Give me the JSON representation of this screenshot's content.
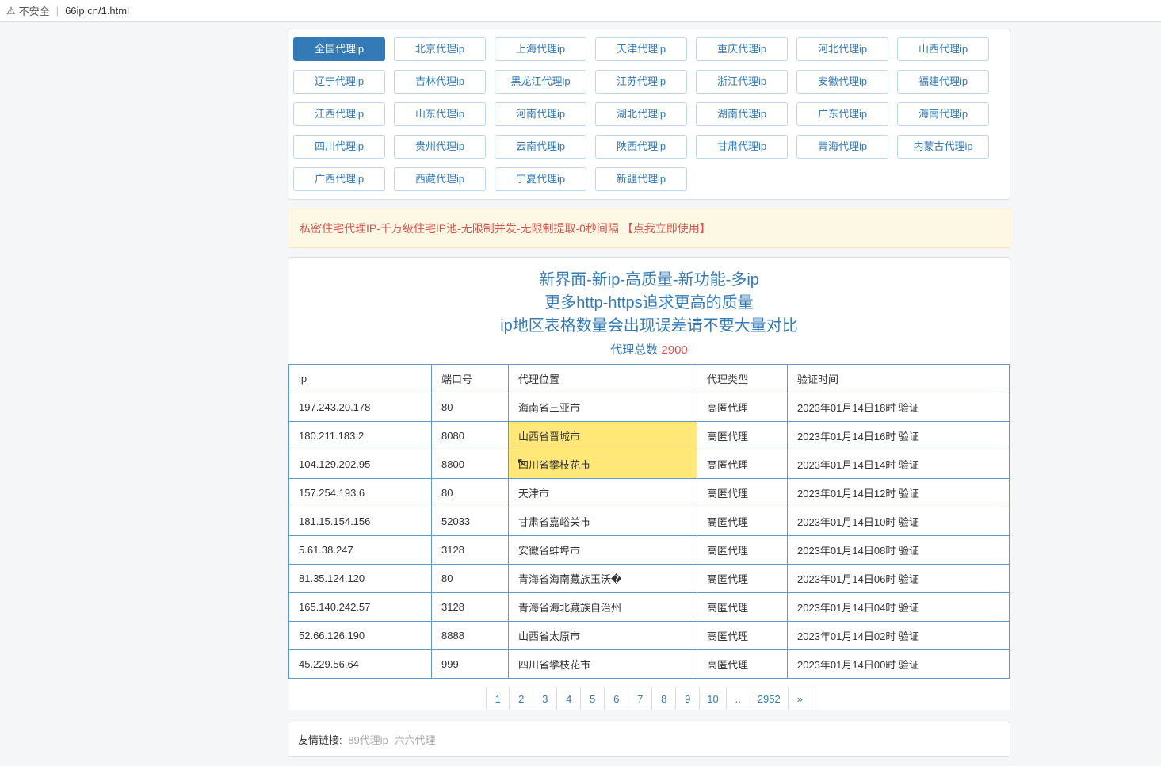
{
  "address_bar": {
    "warn_icon": "⚠",
    "warn_label": "不安全",
    "url": "66ip.cn/1.html"
  },
  "regions": {
    "active_index": 0,
    "items": [
      "全国代理ip",
      "北京代理ip",
      "上海代理ip",
      "天津代理ip",
      "重庆代理ip",
      "河北代理ip",
      "山西代理ip",
      "辽宁代理ip",
      "吉林代理ip",
      "黑龙江代理ip",
      "江苏代理ip",
      "浙江代理ip",
      "安徽代理ip",
      "福建代理ip",
      "江西代理ip",
      "山东代理ip",
      "河南代理ip",
      "湖北代理ip",
      "湖南代理ip",
      "广东代理ip",
      "海南代理ip",
      "四川代理ip",
      "贵州代理ip",
      "云南代理ip",
      "陕西代理ip",
      "甘肃代理ip",
      "青海代理ip",
      "内蒙古代理ip",
      "广西代理ip",
      "西藏代理ip",
      "宁夏代理ip",
      "新疆代理ip"
    ]
  },
  "ad_text": "私密住宅代理IP-千万级住宅IP池-无限制并发-无限制提取-0秒间隔 【点我立即使用】",
  "headlines": {
    "l1": "新界面-新ip-高质量-新功能-多ip",
    "l2": "更多http-https追求更高的质量",
    "l3": "ip地区表格数量会出现误差请不要大量对比",
    "count_label": "代理总数",
    "count_value": "2900"
  },
  "table": {
    "headers": {
      "ip": "ip",
      "port": "端口号",
      "loc": "代理位置",
      "type": "代理类型",
      "time": "验证时间"
    },
    "rows": [
      {
        "ip": "197.243.20.178",
        "port": "80",
        "loc": "海南省三亚市",
        "type": "高匿代理",
        "time": "2023年01月14日18时 验证"
      },
      {
        "ip": "180.211.183.2",
        "port": "8080",
        "loc": "山西省晋城市",
        "type": "高匿代理",
        "time": "2023年01月14日16时 验证"
      },
      {
        "ip": "104.129.202.95",
        "port": "8800",
        "loc": "四川省攀枝花市",
        "type": "高匿代理",
        "time": "2023年01月14日14时 验证"
      },
      {
        "ip": "157.254.193.6",
        "port": "80",
        "loc": "天津市",
        "type": "高匿代理",
        "time": "2023年01月14日12时 验证"
      },
      {
        "ip": "181.15.154.156",
        "port": "52033",
        "loc": "甘肃省嘉峪关市",
        "type": "高匿代理",
        "time": "2023年01月14日10时 验证"
      },
      {
        "ip": "5.61.38.247",
        "port": "3128",
        "loc": "安徽省蚌埠市",
        "type": "高匿代理",
        "time": "2023年01月14日08时 验证"
      },
      {
        "ip": "81.35.124.120",
        "port": "80",
        "loc": "青海省海南藏族玉沃�",
        "type": "高匿代理",
        "time": "2023年01月14日06时 验证"
      },
      {
        "ip": "165.140.242.57",
        "port": "3128",
        "loc": "青海省海北藏族自治州",
        "type": "高匿代理",
        "time": "2023年01月14日04时 验证"
      },
      {
        "ip": "52.66.126.190",
        "port": "8888",
        "loc": "山西省太原市",
        "type": "高匿代理",
        "time": "2023年01月14日02时 验证"
      },
      {
        "ip": "45.229.56.64",
        "port": "999",
        "loc": "四川省攀枝花市",
        "type": "高匿代理",
        "time": "2023年01月14日00时 验证"
      }
    ],
    "highlight_row_index": 1,
    "highlight_col": "loc"
  },
  "pagination": {
    "pages": [
      "1",
      "2",
      "3",
      "4",
      "5",
      "6",
      "7",
      "8",
      "9",
      "10",
      "..",
      "2952",
      "»"
    ],
    "current": "1"
  },
  "friend": {
    "label": "友情链接:",
    "links": [
      "89代理ip",
      "六六代理"
    ]
  }
}
